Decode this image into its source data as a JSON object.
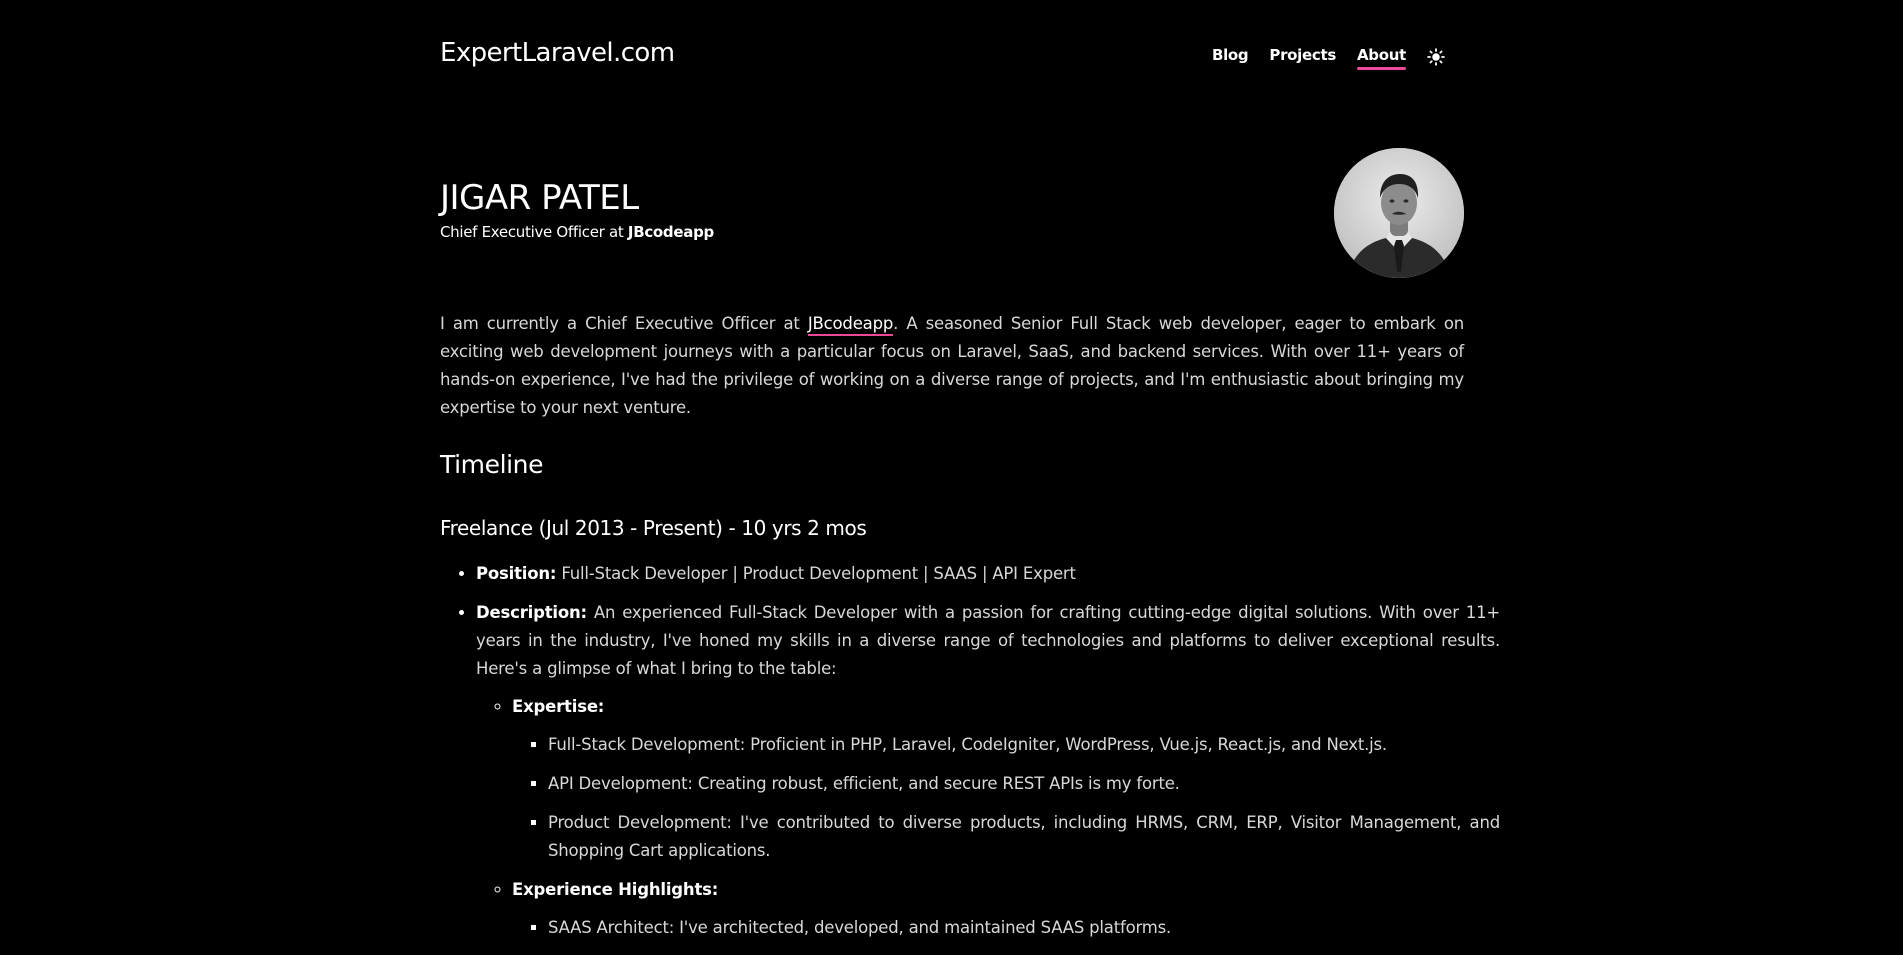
{
  "header": {
    "site_title": "ExpertLaravel.com",
    "nav": {
      "blog": "Blog",
      "projects": "Projects",
      "about": "About"
    },
    "theme_icon": "sun-icon",
    "accent_color": "#ec4899"
  },
  "hero": {
    "name": "JIGAR PATEL",
    "role_prefix": "Chief Executive Officer at",
    "company": "JBcodeapp",
    "avatar": "avatar"
  },
  "intro": {
    "before_link": "I am currently a Chief Executive Officer at ",
    "link_text": "JBcodeapp",
    "after_link": ". A seasoned Senior Full Stack web developer, eager to embark on exciting web development journeys with a particular focus on Laravel, SaaS, and backend services. With over 11+ years of hands-on experience, I've had the privilege of working on a diverse range of projects, and I'm enthusiastic about bringing my expertise to your next venture."
  },
  "timeline": {
    "title": "Timeline",
    "job": {
      "title": "Freelance (Jul 2013 - Present) - 10 yrs 2 mos",
      "position_label": "Position:",
      "position_value": "Full-Stack Developer | Product Development | SAAS | API Expert",
      "description_label": "Description:",
      "description_value": "An experienced Full-Stack Developer with a passion for crafting cutting-edge digital solutions. With over 11+ years in the industry, I've honed my skills in a diverse range of technologies and platforms to deliver exceptional results. Here's a glimpse of what I bring to the table:",
      "expertise_label": "Expertise:",
      "expertise_items": [
        "Full-Stack Development: Proficient in PHP, Laravel, CodeIgniter, WordPress, Vue.js, React.js, and Next.js.",
        "API Development: Creating robust, efficient, and secure REST APIs is my forte.",
        "Product Development: I've contributed to diverse products, including HRMS, CRM, ERP, Visitor Management, and Shopping Cart applications."
      ],
      "highlights_label": "Experience Highlights:",
      "highlights_items": [
        "SAAS Architect: I've architected, developed, and maintained SAAS platforms."
      ]
    }
  }
}
